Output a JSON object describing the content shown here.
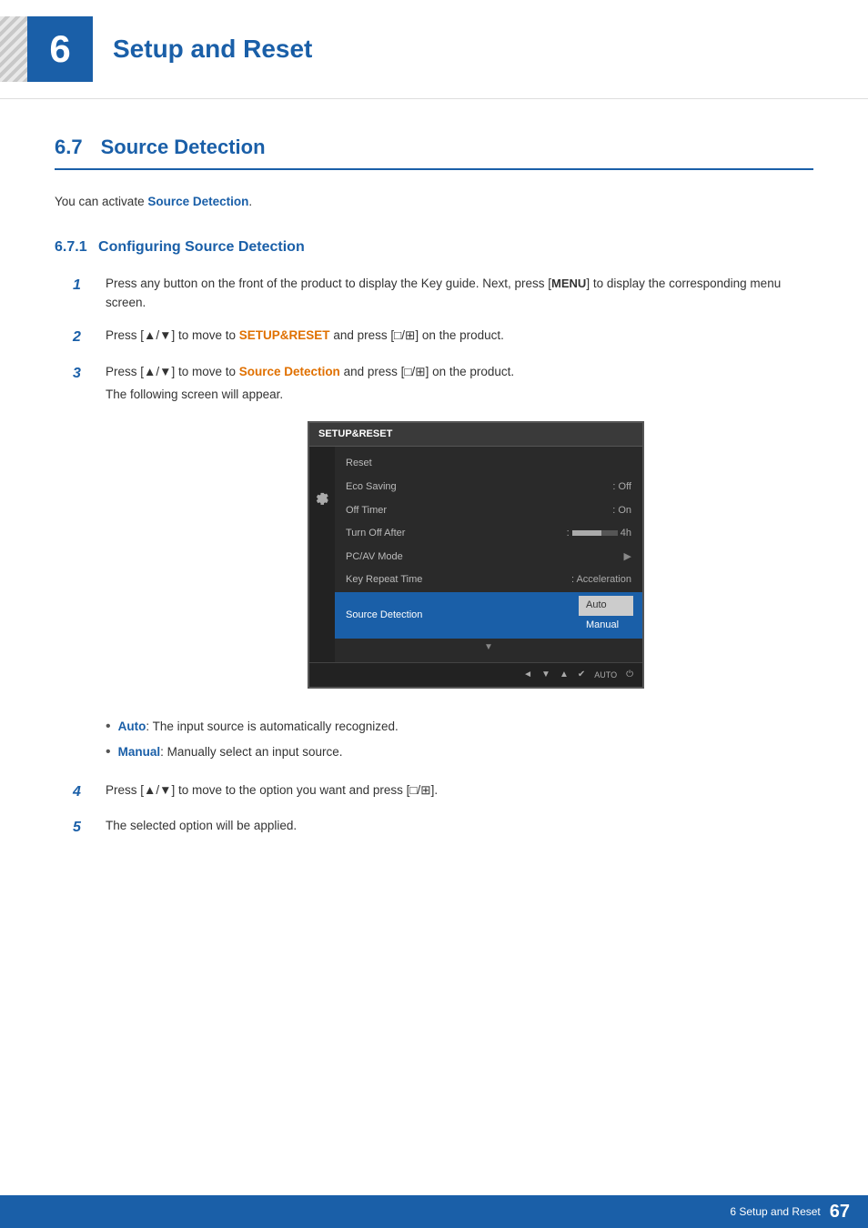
{
  "chapter": {
    "number": "6",
    "title": "Setup and Reset",
    "accent_color": "#1a5fa8"
  },
  "section": {
    "number": "6.7",
    "heading": "Source Detection",
    "intro": "You can activate",
    "intro_highlight": "Source Detection",
    "intro_end": "."
  },
  "subsection": {
    "number": "6.7.1",
    "heading": "Configuring Source Detection"
  },
  "steps": [
    {
      "number": "1",
      "text_parts": [
        {
          "type": "normal",
          "text": "Press any button on the front of the product to display the Key guide. Next, press ["
        },
        {
          "type": "bold",
          "text": "MENU"
        },
        {
          "type": "normal",
          "text": "] to display the corresponding menu screen."
        }
      ]
    },
    {
      "number": "2",
      "text_parts": [
        {
          "type": "normal",
          "text": "Press [▲/▼] to move to "
        },
        {
          "type": "orange",
          "text": "SETUP&RESET"
        },
        {
          "type": "normal",
          "text": " and press [□/⊞] on the product."
        }
      ]
    },
    {
      "number": "3",
      "text_parts": [
        {
          "type": "normal",
          "text": "Press [▲/▼] to move to "
        },
        {
          "type": "orange",
          "text": "Source Detection"
        },
        {
          "type": "normal",
          "text": " and press [□/⊞] on the product."
        }
      ],
      "subtext": "The following screen will appear."
    }
  ],
  "screen": {
    "title": "SETUP&RESET",
    "menu_items": [
      {
        "label": "Reset",
        "value": "",
        "arrow": false,
        "active": false
      },
      {
        "label": "Eco Saving",
        "value": "Off",
        "arrow": false,
        "active": false
      },
      {
        "label": "Off Timer",
        "value": "On",
        "arrow": false,
        "active": false
      },
      {
        "label": "Turn Off After",
        "value": "progress_bar_4h",
        "arrow": false,
        "active": false
      },
      {
        "label": "PC/AV Mode",
        "value": "",
        "arrow": true,
        "active": false
      },
      {
        "label": "Key Repeat Time",
        "value": "Acceleration",
        "arrow": false,
        "active": false
      },
      {
        "label": "Source Detection",
        "value": "",
        "arrow": false,
        "active": true
      }
    ],
    "submenu": [
      "Auto",
      "Manual"
    ],
    "submenu_selected": "Auto",
    "bottom_icons": [
      "◄",
      "▼",
      "▲",
      "✔",
      "AUTO",
      "⏻"
    ]
  },
  "bullets": [
    {
      "label": "Auto",
      "label_type": "blue",
      "text": ": The input source is automatically recognized."
    },
    {
      "label": "Manual",
      "label_type": "blue",
      "text": ": Manually select an input source."
    }
  ],
  "steps_continued": [
    {
      "number": "4",
      "text": "Press [▲/▼] to move to the option you want and press [□/⊞]."
    },
    {
      "number": "5",
      "text": "The selected option will be applied."
    }
  ],
  "footer": {
    "text": "6 Setup and Reset",
    "page": "67"
  }
}
